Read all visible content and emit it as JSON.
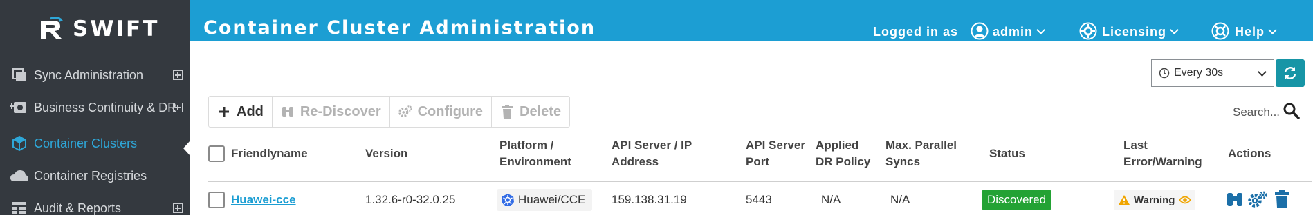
{
  "app": {
    "logo_text": "SWIFT",
    "colors": {
      "header_bg": "#1c9ed3",
      "sidebar_bg": "#34393f",
      "active": "#2ea7d8",
      "success": "#23a234",
      "warning": "#f0a500",
      "refresh": "#1795a6"
    }
  },
  "sidebar": {
    "items": [
      {
        "label": "Sync Administration",
        "icon": "sync-icon",
        "expandable": true,
        "active": false
      },
      {
        "label": "Business Continuity & DR",
        "icon": "business-continuity-icon",
        "expandable": true,
        "active": false
      },
      {
        "label": "Container Clusters",
        "icon": "cube-icon",
        "expandable": false,
        "active": true
      },
      {
        "label": "Container Registries",
        "icon": "cloud-icon",
        "expandable": false,
        "active": false
      },
      {
        "label": "Audit & Reports",
        "icon": "table-icon",
        "expandable": true,
        "active": false
      }
    ]
  },
  "header": {
    "title": "Container Cluster Administration",
    "logged_in_label": "Logged in as",
    "user": "admin",
    "licensing": "Licensing",
    "help": "Help"
  },
  "refresh": {
    "interval": "Every 30s"
  },
  "toolbar": {
    "add": "Add",
    "rediscover": "Re-Discover",
    "configure": "Configure",
    "delete": "Delete"
  },
  "search": {
    "placeholder": "Search..."
  },
  "table": {
    "columns": {
      "friendlyname": "Friendlyname",
      "version": "Version",
      "platform_l1": "Platform /",
      "platform_l2": "Environment",
      "api_l1": "API Server / IP",
      "api_l2": "Address",
      "port_l1": "API Server",
      "port_l2": "Port",
      "dr_l1": "Applied",
      "dr_l2": "DR Policy",
      "syncs_l1": "Max. Parallel",
      "syncs_l2": "Syncs",
      "status": "Status",
      "err_l1": "Last",
      "err_l2": "Error/Warning",
      "actions": "Actions"
    },
    "rows": [
      {
        "friendlyname": "Huawei-cce",
        "version": "1.32.6-r0-32.0.25",
        "platform": "Huawei/CCE",
        "api_address": "159.138.31.19",
        "port": "5443",
        "dr_policy": "N/A",
        "max_syncs": "N/A",
        "status": "Discovered",
        "last_error": "Warning"
      }
    ]
  }
}
